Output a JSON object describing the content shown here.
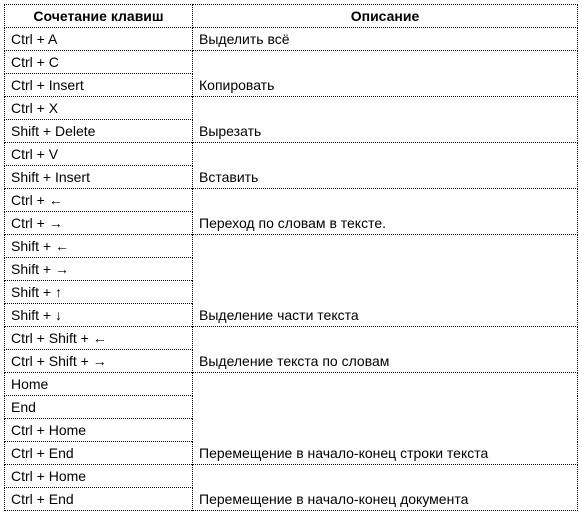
{
  "headers": {
    "shortcut": "Сочетание клавиш",
    "description": "Описание"
  },
  "rows": [
    {
      "shortcut": "Ctrl + A",
      "description": "Выделить всё",
      "span": 1
    },
    {
      "shortcut": "Ctrl + C"
    },
    {
      "shortcut": "Ctrl + Insert",
      "description": "Копировать",
      "span": 2
    },
    {
      "shortcut": "Ctrl + X"
    },
    {
      "shortcut": "Shift + Delete",
      "description": "Вырезать",
      "span": 2
    },
    {
      "shortcut": "Ctrl + V"
    },
    {
      "shortcut": "Shift + Insert",
      "description": "Вставить",
      "span": 2
    },
    {
      "shortcut": "Ctrl + ←"
    },
    {
      "shortcut": "Ctrl + →",
      "description": "Переход по словам в тексте.",
      "span": 2
    },
    {
      "shortcut": "Shift + ←"
    },
    {
      "shortcut": "Shift + →"
    },
    {
      "shortcut": "Shift + ↑"
    },
    {
      "shortcut": "Shift + ↓",
      "description": "Выделение части текста",
      "span": 4
    },
    {
      "shortcut": "Ctrl + Shift + ←"
    },
    {
      "shortcut": "Ctrl + Shift + →",
      "description": "Выделение текста по словам",
      "span": 2
    },
    {
      "shortcut": "Home"
    },
    {
      "shortcut": "End"
    },
    {
      "shortcut": "Ctrl + Home"
    },
    {
      "shortcut": "Ctrl + End",
      "description": "Перемещение в начало-конец строки текста",
      "span": 4
    },
    {
      "shortcut": "Ctrl + Home"
    },
    {
      "shortcut": "Ctrl + End",
      "description": "Перемещение в начало-конец документа",
      "span": 2
    }
  ]
}
